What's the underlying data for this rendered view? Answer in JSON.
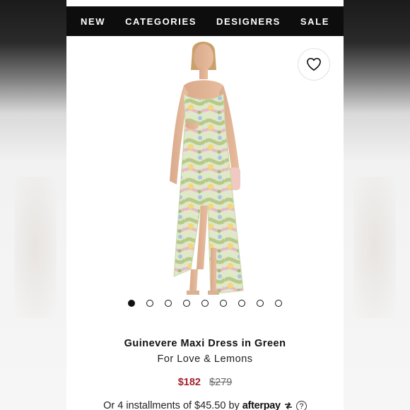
{
  "nav": {
    "items": [
      {
        "label": "NEW"
      },
      {
        "label": "CATEGORIES"
      },
      {
        "label": "DESIGNERS"
      },
      {
        "label": "SALE"
      }
    ]
  },
  "product": {
    "image_icon": "dress-model-photo",
    "wishlist_icon": "heart-icon",
    "carousel": {
      "count": 9,
      "active_index": 0
    },
    "title": "Guinevere Maxi Dress in Green",
    "designer": "For Love & Lemons",
    "price_sale": "$182",
    "price_original": "$279",
    "colors": {
      "sale_price": "#a4212c"
    }
  },
  "afterpay": {
    "text": "Or 4 installments of $45.50 by",
    "logo_text": "afterpay",
    "help_icon": "question-circle-icon",
    "help_glyph": "?"
  }
}
